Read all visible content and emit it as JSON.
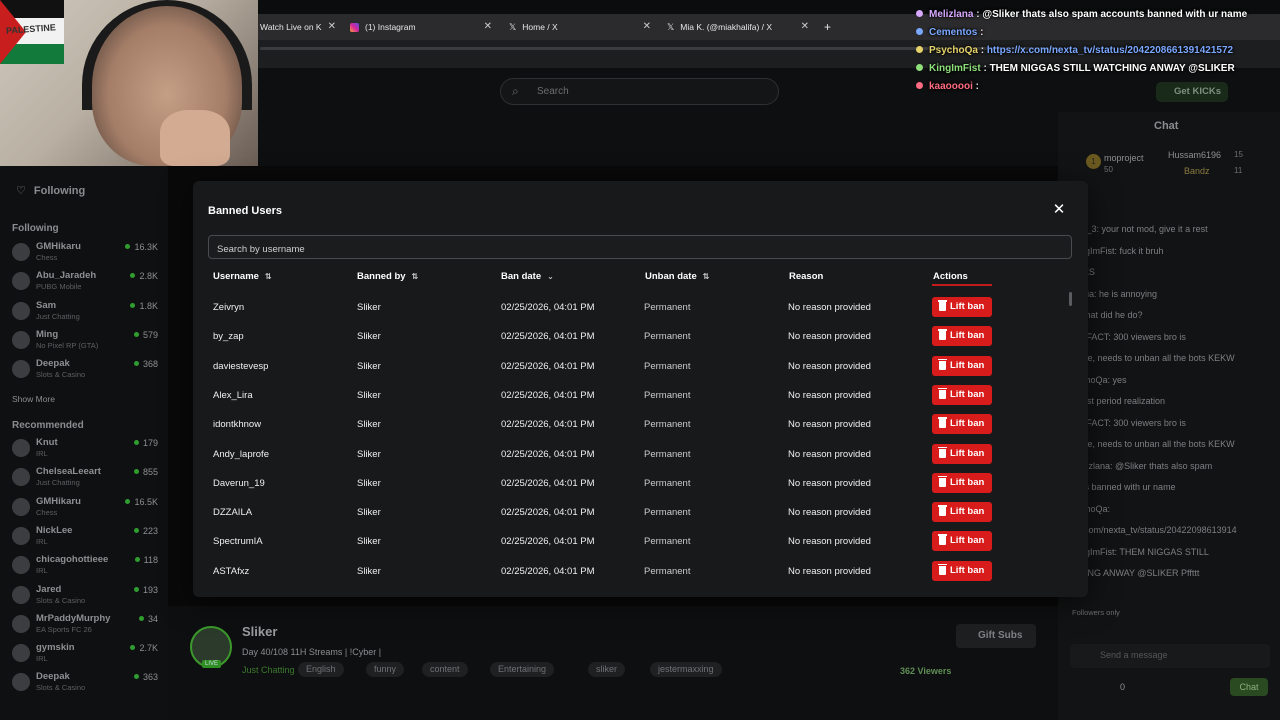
{
  "browser": {
    "tabs": [
      {
        "label": "Watch Live on K",
        "icon": "kick-icon"
      },
      {
        "label": "(1) Instagram",
        "icon": "instagram-icon"
      },
      {
        "label": "Home / X",
        "icon": "x-icon"
      },
      {
        "label": "Mia K. (@miakhalifa) / X",
        "icon": "x-icon"
      }
    ],
    "new_tab": "+"
  },
  "webcam": {
    "flag_text": "PALESTINE"
  },
  "stream_chat": [
    {
      "user": "Melizlana",
      "text": "@Sliker thats also spam accounts banned with ur name",
      "user_color": "#d6a9ff",
      "text_color": "#ffffff"
    },
    {
      "user": "Cementos",
      "text": "",
      "user_color": "#7aa7ff",
      "text_color": "#ffffff"
    },
    {
      "user": "PsychoQa",
      "text": "https://x.com/nexta_tv/status/2042208661391421572",
      "user_color": "#e6d36a",
      "text_color": "#7aa7ff"
    },
    {
      "user": "KingImFist",
      "text": "THEM NIGGAS STILL WATCHING ANWAY @SLIKER",
      "user_color": "#8ee07a",
      "text_color": "#ffffff"
    },
    {
      "user": "kaaooooi",
      "text": "",
      "user_color": "#ff6b81",
      "text_color": "#ffffff"
    }
  ],
  "kick": {
    "search_placeholder": "Search",
    "get_kicks": "Get KICKs",
    "sidebar": {
      "following_title": "Following",
      "following_header": "Following",
      "following": [
        {
          "name": "GMHikaru",
          "sub": "Chess",
          "count": "16.3K"
        },
        {
          "name": "Abu_Jaradeh",
          "sub": "PUBG Mobile",
          "count": "2.8K"
        },
        {
          "name": "Sam",
          "sub": "Just Chatting",
          "count": "1.8K"
        },
        {
          "name": "Ming",
          "sub": "No Pixel RP (GTA)",
          "count": "579"
        },
        {
          "name": "Deepak",
          "sub": "Slots & Casino",
          "count": "368"
        }
      ],
      "show_more": "Show More",
      "recommended_header": "Recommended",
      "recommended": [
        {
          "name": "Knut",
          "sub": "IRL",
          "count": "179"
        },
        {
          "name": "ChelseaLeeart",
          "sub": "Just Chatting",
          "count": "855"
        },
        {
          "name": "GMHikaru",
          "sub": "Chess",
          "count": "16.5K"
        },
        {
          "name": "NickLee",
          "sub": "IRL",
          "count": "223"
        },
        {
          "name": "chicagohottieee",
          "sub": "IRL",
          "count": "118"
        },
        {
          "name": "Jared",
          "sub": "Slots & Casino",
          "count": "193"
        },
        {
          "name": "MrPaddyMurphy",
          "sub": "EA Sports FC 26",
          "count": "34"
        },
        {
          "name": "gymskin",
          "sub": "IRL",
          "count": "2.7K"
        },
        {
          "name": "Deepak",
          "sub": "Slots & Casino",
          "count": "363"
        }
      ]
    },
    "stream": {
      "channel": "Sliker",
      "title": "Day 40/108 11H Streams | !Cyber |",
      "category": "Just Chatting",
      "tags": [
        "English",
        "funny",
        "content",
        "Entertaining",
        "sliker",
        "jestermaxxing"
      ],
      "viewers": "362 Viewers",
      "gift_subs": "Gift Subs",
      "live_badge": "LIVE"
    },
    "chat": {
      "title": "Chat",
      "leaderboard": [
        {
          "rank": "1",
          "name": "moproject",
          "count": "50"
        },
        {
          "name": "Hussam6196",
          "count": "15"
        },
        {
          "name": "Bandz",
          "count": "11"
        }
      ],
      "messages": [
        "nas_3: your not mod, give it a rest",
        "KingImFist: fuck it bruh",
        ": YES",
        "uuuia: he is annoying",
        ": What did he do?",
        "RTIFACT: 300 viewers  bro is",
        "erate, needs to unban all the bots KEKW",
        "sychoQa: yes",
        ": post period realization",
        "RTIFACT: 300 viewers  bro is",
        "erate, needs to unban all the bots KEKW",
        "Melizlana: @Sliker thats also spam",
        "unts banned with ur name",
        "sychoQa:",
        "//x.com/nexta_tv/status/20422098613914",
        "KingImFist: THEM NIGGAS STILL",
        "CHING ANWAY @SLIKER Pffttt"
      ],
      "followers_only": "Followers only",
      "send_placeholder": "Send a message",
      "send_button": "Chat",
      "points": "0"
    }
  },
  "modal": {
    "title": "Banned Users",
    "search_placeholder": "Search by username",
    "columns": {
      "username": "Username",
      "banned_by": "Banned by",
      "ban_date": "Ban date",
      "unban_date": "Unban date",
      "reason": "Reason",
      "actions": "Actions"
    },
    "lift_label": "Lift ban",
    "rows": [
      {
        "username": "Zeivryn",
        "banned_by": "Sliker",
        "ban_date": "02/25/2026, 04:01 PM",
        "unban_date": "Permanent",
        "reason": "No reason provided"
      },
      {
        "username": "by_zap",
        "banned_by": "Sliker",
        "ban_date": "02/25/2026, 04:01 PM",
        "unban_date": "Permanent",
        "reason": "No reason provided"
      },
      {
        "username": "daviestevesp",
        "banned_by": "Sliker",
        "ban_date": "02/25/2026, 04:01 PM",
        "unban_date": "Permanent",
        "reason": "No reason provided"
      },
      {
        "username": "Alex_Lira",
        "banned_by": "Sliker",
        "ban_date": "02/25/2026, 04:01 PM",
        "unban_date": "Permanent",
        "reason": "No reason provided"
      },
      {
        "username": "idontkhnow",
        "banned_by": "Sliker",
        "ban_date": "02/25/2026, 04:01 PM",
        "unban_date": "Permanent",
        "reason": "No reason provided"
      },
      {
        "username": "Andy_laprofe",
        "banned_by": "Sliker",
        "ban_date": "02/25/2026, 04:01 PM",
        "unban_date": "Permanent",
        "reason": "No reason provided"
      },
      {
        "username": "Daverun_19",
        "banned_by": "Sliker",
        "ban_date": "02/25/2026, 04:01 PM",
        "unban_date": "Permanent",
        "reason": "No reason provided"
      },
      {
        "username": "DZZAILA",
        "banned_by": "Sliker",
        "ban_date": "02/25/2026, 04:01 PM",
        "unban_date": "Permanent",
        "reason": "No reason provided"
      },
      {
        "username": "SpectrumIA",
        "banned_by": "Sliker",
        "ban_date": "02/25/2026, 04:01 PM",
        "unban_date": "Permanent",
        "reason": "No reason provided"
      },
      {
        "username": "ASTAfxz",
        "banned_by": "Sliker",
        "ban_date": "02/25/2026, 04:01 PM",
        "unban_date": "Permanent",
        "reason": "No reason provided"
      }
    ]
  },
  "colors": {
    "accent_green": "#53fc18",
    "danger_red": "#d81c1c",
    "modal_bg": "#18191b"
  }
}
